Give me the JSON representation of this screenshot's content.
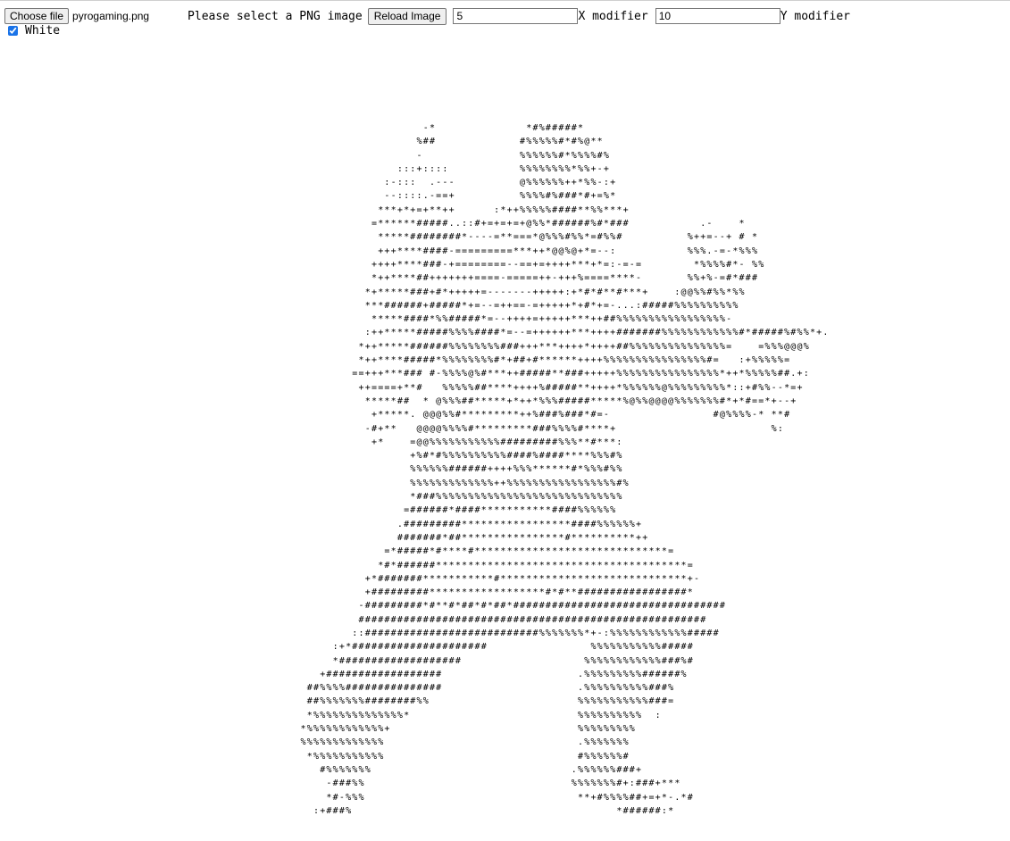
{
  "toolbar": {
    "choose_file_label": "Choose file",
    "file_name": "pyrogaming.png",
    "prompt": "Please select a PNG image",
    "reload_label": "Reload Image",
    "x_value": "5",
    "x_label": "X modifier",
    "y_value": "10",
    "y_label": "Y modifier"
  },
  "options": {
    "white_label": "White",
    "white_checked": true
  },
  "ascii_art": "                          -*              *#%#####*\n                         %##             #%%%%%#*#%@**\n                         -               %%%%%%#*%%%%#%\n                      :::+::::           %%%%%%%%*%%+-+\n                    :-:::  .---          @%%%%%%++*%%-:+\n                    --::::.-==+          %%%%#%###*#+=%*\n                   ***+*+=+**++      :*++%%%%%####**%%***+\n                  =******#####..::#+=+=+=+@%%*######%#*###           .-    *\n                   *****########*----=**===*@%%%#%%*=#%%#          %++=--+ # *\n                   +++****####-=========***++*@@%@+*=--:           %%%.-=-*%%%\n                  ++++****###-+========--==+=++++***+*=:-=-=        *%%%%#*- %%\n                  *++****##+++++++====-=====++-+++%====****-       %%+%-=#*###\n                 *+*****###+#*+++++=-------+++++:+*#*#**#***+    :@@%%#%%*%%\n                 ***######+#####*+=--=++==-=+++++*+#*+=-...:#####%%%%%%%%%%\n                  *****####*%%#####*=--++++=+++++***++##%%%%%%%%%%%%%%%%%-\n                 :++*****#####%%%%####*=--=++++++***++++#######%%%%%%%%%%%%#*#####%#%%*+.\n                *++*****######%%%%%%%%###+++***++++*++++##%%%%%%%%%%%%%%%=    =%%%@@@%\n                *++****#####*%%%%%%%%#*+##+#******++++%%%%%%%%%%%%%%%%#=   :+%%%%%=\n               ==+++***### #-%%%%@%#***++#####**###+++++%%%%%%%%%%%%%%%%*++*%%%%%##.+:\n                ++====+**#   %%%%%##****++++%#####**++++*%%%%%%@%%%%%%%%%*::+#%%--*=+\n                 *****##  * @%%%##*****+*++*%%%#####*****%@%%@@@@%%%%%%%#*+*#==*+--+\n                  +*****. @@@%%#*********++%###%###*#=-                #@%%%%-* **#\n                 -#+**   @@@@%%%%#*********###%%%%#****+                        %:\n                  +*    =@@%%%%%%%%%%%#########%%%**#***:\n                        +%#*#%%%%%%%%%%####%####****%%%#%\n                        %%%%%%######++++%%%******#*%%%#%%\n                        %%%%%%%%%%%%%++%%%%%%%%%%%%%%%%%#%\n                        *###%%%%%%%%%%%%%%%%%%%%%%%%%%%%%\n                       =######*####***********####%%%%%%\n                      .#########*****************####%%%%%%+\n                      #######*##****************#**********++\n                    =*#####*#****#******************************=\n                   *#*######***************************************=\n                 +*#######***********#*****************************+-\n                 +#########******************#*#**#################*\n                -#########*#**#*##*#*##*#################################\n                ######################################################\n               ::###########################%%%%%%%*+-:%%%%%%%%%%%%#####\n            :+*#####################                %%%%%%%%%%%#####\n            *###################                   %%%%%%%%%%%%###%#\n          +##################                     .%%%%%%%%%######%\n        ##%%%%###############                     .%%%%%%%%%%###%\n        ##%%%%%%%########%%                       %%%%%%%%%%%###=\n        *%%%%%%%%%%%%%%*                          %%%%%%%%%%  :\n       *%%%%%%%%%%%%+                             %%%%%%%%%\n       %%%%%%%%%%%%%                              .%%%%%%%\n        *%%%%%%%%%%%                              #%%%%%%#\n          #%%%%%%%                               .%%%%%%###+\n           -###%%                                %%%%%%%#+:###+***\n           *#-%%%                                 **+#%%%%##+=+*-.*#\n         :+###%                                         *######:*"
}
